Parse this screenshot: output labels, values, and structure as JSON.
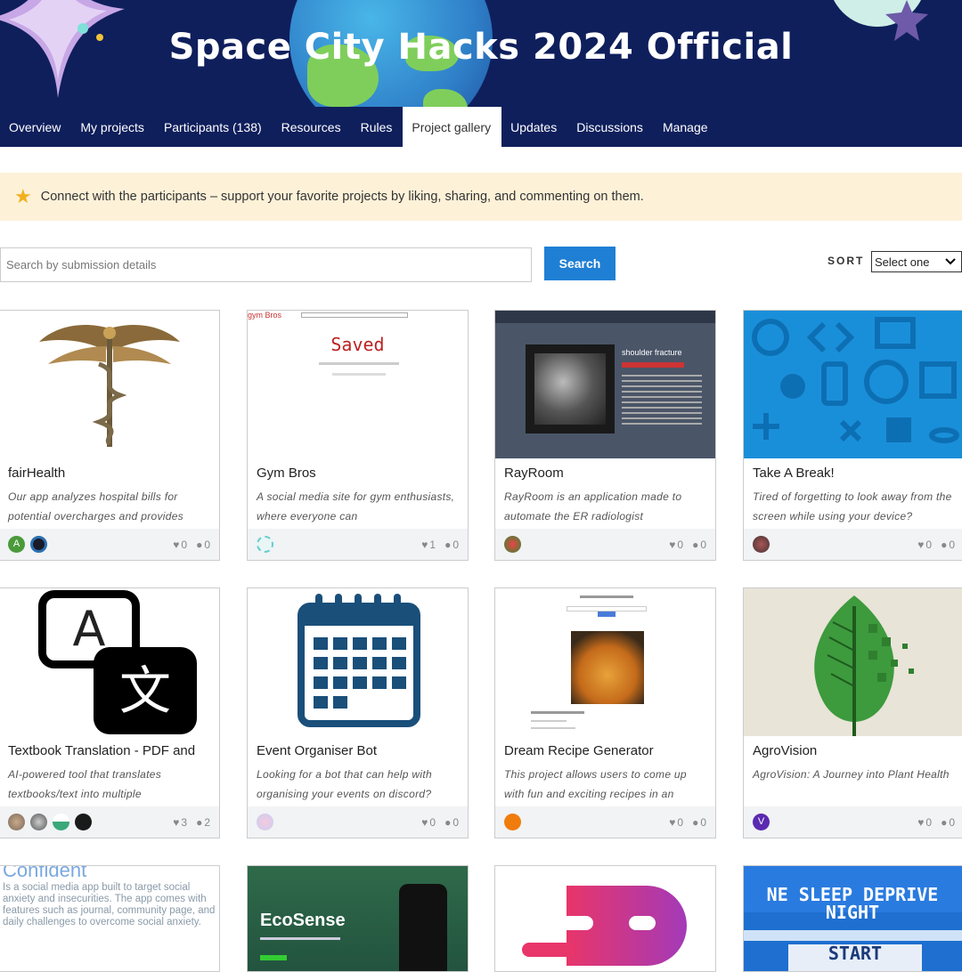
{
  "header": {
    "title": "Space City Hacks 2024 Official"
  },
  "nav": [
    {
      "label": "Overview"
    },
    {
      "label": "My projects"
    },
    {
      "label": "Participants (138)"
    },
    {
      "label": "Resources"
    },
    {
      "label": "Rules"
    },
    {
      "label": "Project gallery",
      "active": true
    },
    {
      "label": "Updates"
    },
    {
      "label": "Discussions"
    },
    {
      "label": "Manage"
    }
  ],
  "notice": {
    "text": "Connect with the participants – support your favorite projects by liking, sharing, and commenting on them."
  },
  "search": {
    "placeholder": "Search by submission details",
    "button": "Search"
  },
  "sort": {
    "label": "SORT",
    "selected": "Select one"
  },
  "projects": [
    {
      "name": "fairHealth",
      "desc": "Our app analyzes hospital bills for potential overcharges and provides",
      "likes": "0",
      "comments": "0"
    },
    {
      "name": "Gym Bros",
      "desc": "A social media site for gym enthusiasts, where everyone can",
      "likes": "1",
      "comments": "0",
      "thumb_text": "Saved",
      "thumb_brand": "gym Bros"
    },
    {
      "name": "RayRoom",
      "desc": "RayRoom is an application made to automate the ER radiologist",
      "likes": "0",
      "comments": "0",
      "thumb_text": "shoulder fracture"
    },
    {
      "name": "Take A Break!",
      "desc": "Tired of forgetting to look away from the screen while using your device?",
      "likes": "0",
      "comments": "0"
    },
    {
      "name": "Textbook Translation - PDF and",
      "desc": "AI-powered tool that translates textbooks/text into multiple",
      "likes": "3",
      "comments": "2",
      "thumb_text_a": "A",
      "thumb_text_b": "文"
    },
    {
      "name": "Event Organiser Bot",
      "desc": "Looking for a bot that can help with organising your events on discord?",
      "likes": "0",
      "comments": "0"
    },
    {
      "name": "Dream Recipe Generator",
      "desc": "This project allows users to come up with fun and exciting recipes in an",
      "likes": "0",
      "comments": "0"
    },
    {
      "name": "AgroVision",
      "desc": "AgroVision: A Journey into Plant Health",
      "likes": "0",
      "comments": "0"
    }
  ],
  "row3": {
    "confident_title": "Confident",
    "confident_text": "Is a social media app built to target social anxiety and insecurities. The app comes with features such as journal, community page, and daily challenges to overcome social anxiety.",
    "ecosense_title": "EcoSense",
    "sleep_title": "NE SLEEP DEPRIVE NIGHT",
    "sleep_start": "START"
  },
  "avatar_letters": {
    "a": "A",
    "v": "V"
  },
  "colors": {
    "navy": "#0f1f5c",
    "button": "#1f7fd4",
    "notice_bg": "#fdf1d8"
  }
}
